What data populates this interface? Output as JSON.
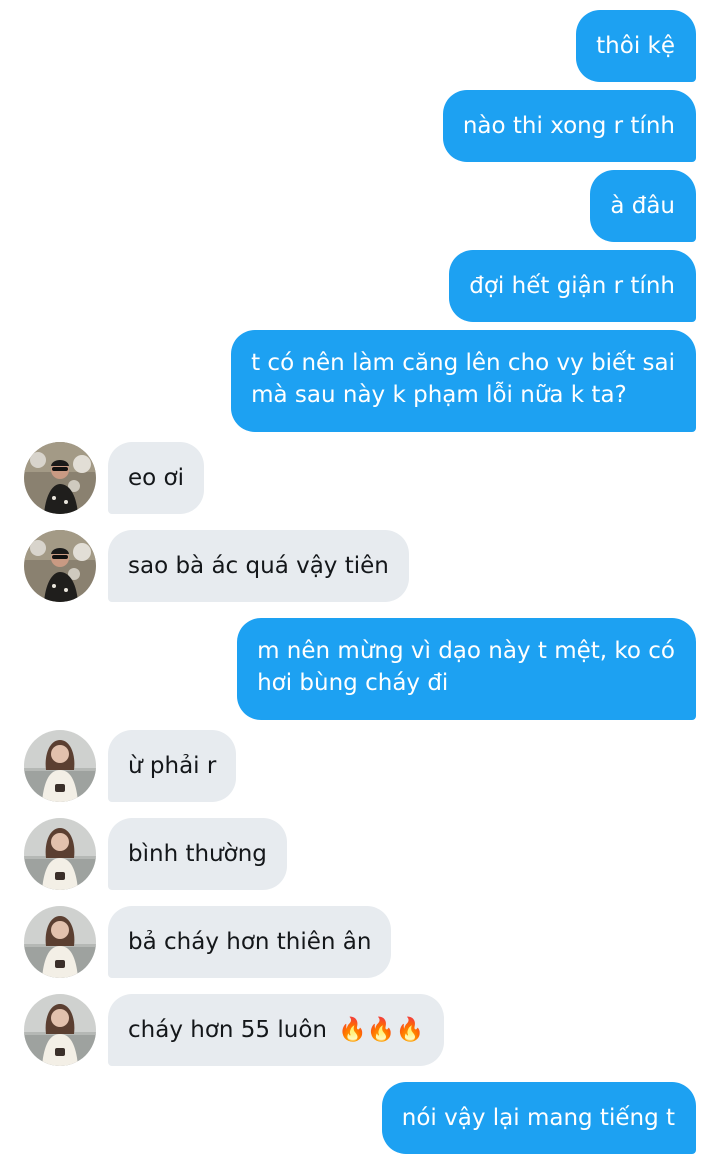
{
  "messages": [
    {
      "side": "out",
      "text": "thôi kệ"
    },
    {
      "side": "out",
      "text": "nào thi xong r tính"
    },
    {
      "side": "out",
      "text": "à đâu"
    },
    {
      "side": "out",
      "text": "đợi hết giận r tính"
    },
    {
      "side": "out",
      "lines": [
        "t có nên làm căng lên cho vy biết sai",
        "mà sau này k phạm lỗi nữa k ta?"
      ]
    },
    {
      "side": "in",
      "avatar": "avatar-a",
      "text": "eo ơi"
    },
    {
      "side": "in",
      "avatar": "avatar-a",
      "text": "sao bà ác quá vậy tiên"
    },
    {
      "side": "out",
      "lines": [
        "m nên mừng vì dạo này t mệt, ko có",
        "hơi bùng cháy đi"
      ]
    },
    {
      "side": "in",
      "avatar": "avatar-b",
      "text": "ừ phải r"
    },
    {
      "side": "in",
      "avatar": "avatar-b",
      "text": "bình thường"
    },
    {
      "side": "in",
      "avatar": "avatar-b",
      "text": "bả cháy hơn thiên ân"
    },
    {
      "side": "in",
      "avatar": "avatar-b",
      "text": "cháy hơn 55 luôn",
      "emoji": "🔥🔥🔥"
    },
    {
      "side": "out",
      "text": "nói vậy lại mang tiếng t"
    }
  ],
  "colors": {
    "outgoing_bubble": "#1da1f2",
    "incoming_bubble": "#e7ebef",
    "outgoing_text": "#ffffff",
    "incoming_text": "#14171a"
  }
}
